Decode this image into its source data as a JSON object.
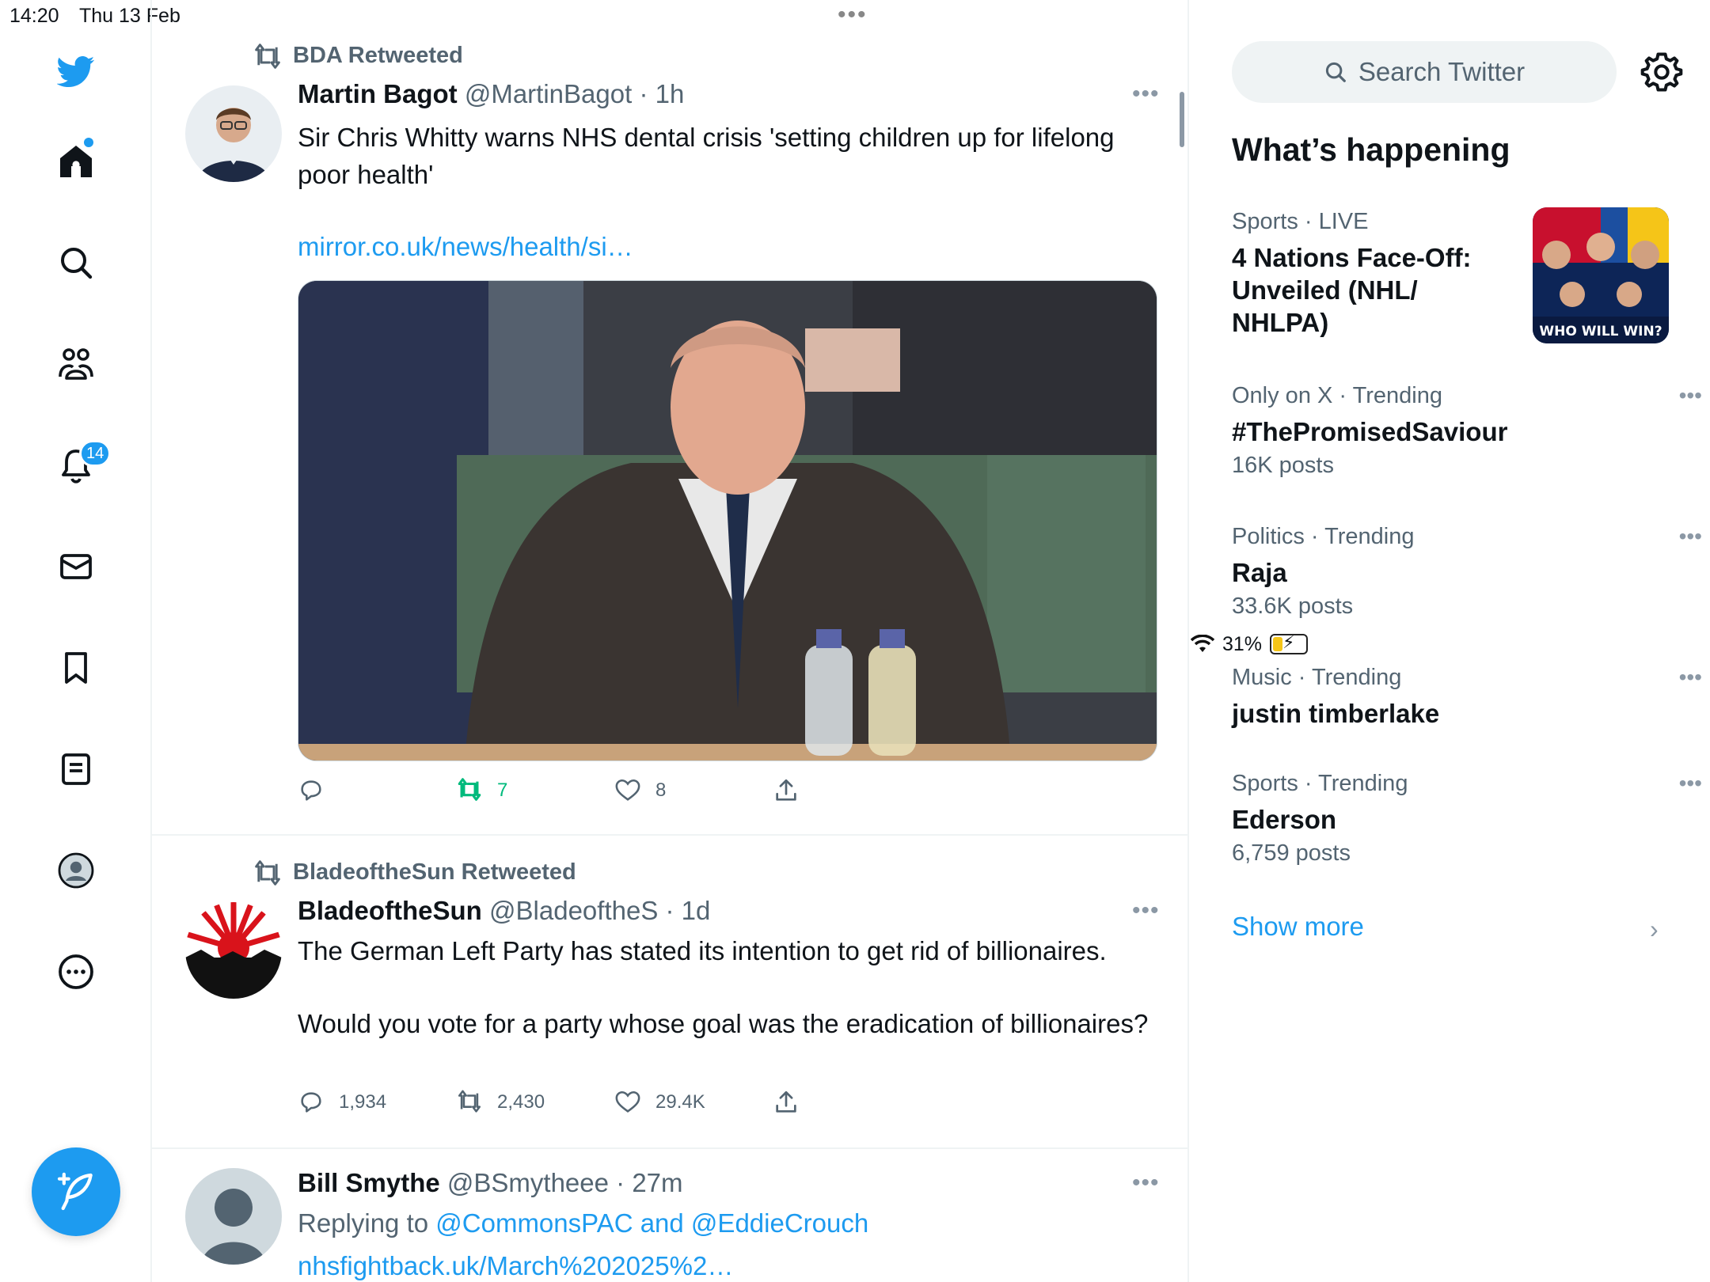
{
  "status_bar": {
    "time": "14:20",
    "date": "Thu 13 Feb",
    "battery": "31%",
    "battery_level": 0.31
  },
  "sidebar": {
    "notifications_count": "14",
    "items": [
      "twitter-logo",
      "home",
      "explore",
      "communities",
      "notifications",
      "messages",
      "bookmarks",
      "lists",
      "profile",
      "more"
    ]
  },
  "tweets": [
    {
      "retweeted_by": "BDA Retweeted",
      "name": "Martin Bagot",
      "handle": "@MartinBagot",
      "time": "· 1h",
      "text": "Sir Chris Whitty warns NHS dental crisis 'setting children up for lifelong poor health'",
      "link": "mirror.co.uk/news/health/si…",
      "replies": "",
      "retweets": "7",
      "likes": "8"
    },
    {
      "retweeted_by": "BladeoftheSun Retweeted",
      "name": "BladeoftheSun",
      "handle": "@BladeoftheS",
      "time": "· 1d",
      "text1": "The German Left Party has stated its intention to get rid of billionaires.",
      "text2": "Would you vote for a party whose goal was the eradication of billionaires?",
      "replies": "1,934",
      "retweets": "2,430",
      "likes": "29.4K"
    },
    {
      "name": "Bill Smythe",
      "handle": "@BSmytheee",
      "time": "· 27m",
      "replying_prefix": "Replying to ",
      "replying_to": "@CommonsPAC and @EddieCrouch",
      "link": "nhsfightback.uk/March%202025%2…"
    }
  ],
  "search": {
    "placeholder": "Search Twitter"
  },
  "whats_happening": {
    "title": "What’s happening",
    "trends": [
      {
        "category": "Sports",
        "meta": " · LIVE",
        "title": "4 Nations Face-Off: Unveiled (NHL/ NHLPA)",
        "count": "",
        "thumb_text": "WHO WILL WIN?"
      },
      {
        "category": "Only on X · Trending",
        "meta": "",
        "title": "#ThePromisedSaviour",
        "count": "16K posts"
      },
      {
        "category": "Politics · Trending",
        "meta": "",
        "title": "Raja",
        "count": "33.6K posts"
      },
      {
        "category": "Music · Trending",
        "meta": "",
        "title": "justin timberlake",
        "count": ""
      },
      {
        "category": "Sports · Trending",
        "meta": "",
        "title": "Ederson",
        "count": "6,759 posts"
      }
    ],
    "show_more": "Show more"
  },
  "colors": {
    "accent": "#1d9bf0",
    "retweet_active": "#00ba7c",
    "muted": "#536471"
  }
}
